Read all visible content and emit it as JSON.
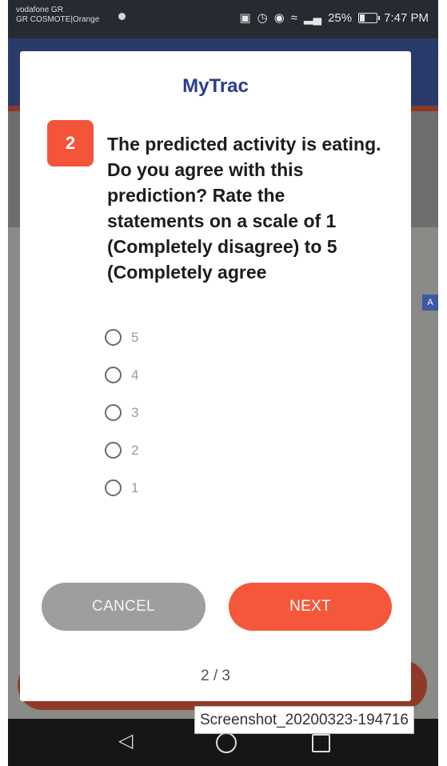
{
  "status_bar": {
    "carrier_line1": "vodafone GR",
    "carrier_line2": "GR COSMOTE|Orange",
    "battery_text": "25%",
    "time": "7:47 PM"
  },
  "background_app": {
    "map_edge_label": "A"
  },
  "dialog": {
    "title": "MyTrac",
    "question_number": "2",
    "question_text": "The predicted activity is eating. Do you agree with this prediction? Rate the statements on a scale of 1 (Completely disagree) to 5 (Completely agree",
    "options": [
      "5",
      "4",
      "3",
      "2",
      "1"
    ],
    "cancel_label": "CANCEL",
    "next_label": "NEXT",
    "pager": "2 / 3"
  },
  "caption": "Screenshot_20200323-194716",
  "colors": {
    "accent": "#f5573b",
    "title": "#2c3b8f",
    "cancel": "#9e9e9e"
  }
}
